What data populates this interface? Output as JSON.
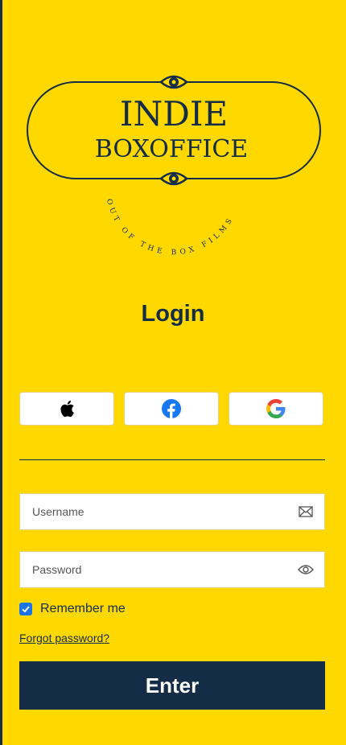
{
  "colors": {
    "background": "#FFD800",
    "navy": "#142C46",
    "facebook": "#1877F2",
    "checkbox": "#1A73E8"
  },
  "logo": {
    "line1": "INDIE",
    "line2": "BOXOFFICE",
    "tagline": "OUT OF THE BOX FILMS"
  },
  "page_title": "Login",
  "social": [
    {
      "name": "apple",
      "icon": "apple-icon"
    },
    {
      "name": "facebook",
      "icon": "facebook-icon"
    },
    {
      "name": "google",
      "icon": "google-icon"
    }
  ],
  "form": {
    "username_placeholder": "Username",
    "username_icon": "envelope-icon",
    "password_placeholder": "Password",
    "password_icon": "eye-icon",
    "remember_label": "Remember me",
    "remember_checked": true,
    "forgot_label": "Forgot password?",
    "submit_label": "Enter"
  }
}
